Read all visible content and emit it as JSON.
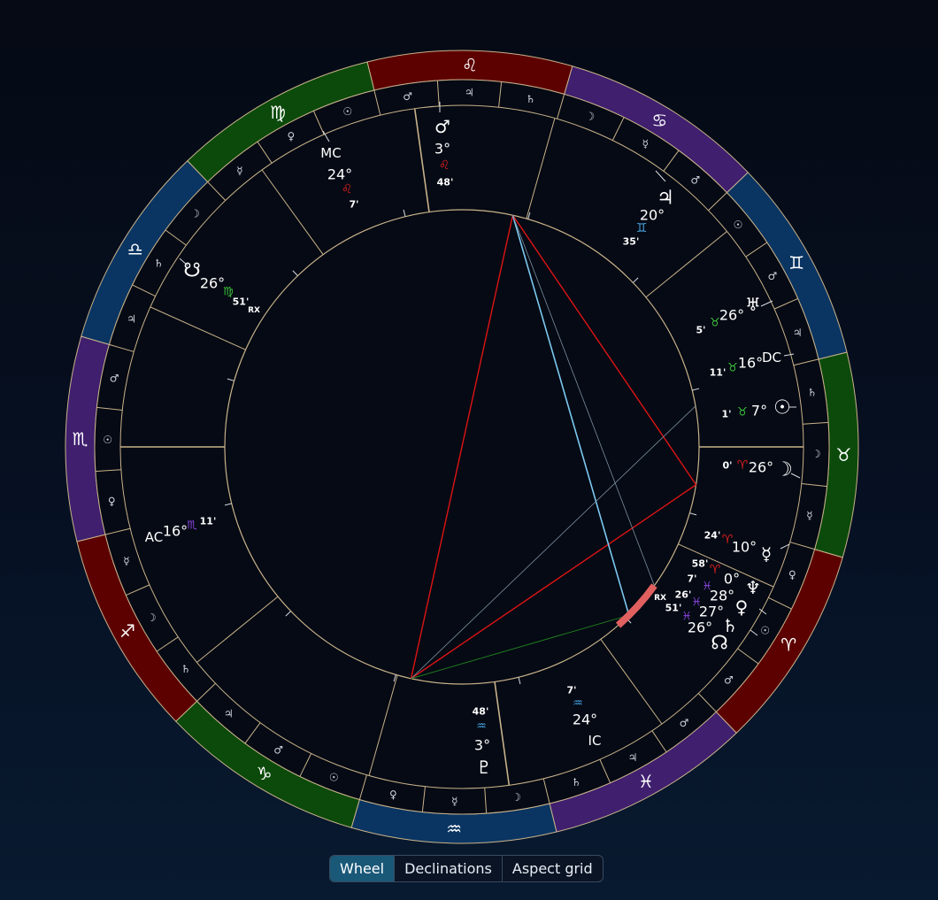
{
  "colors": {
    "fire": "#5c0000",
    "earth": "#0b4a0b",
    "air": "#0a3562",
    "water": "#3f1f6e",
    "ring_stroke": "#c9b28a",
    "label": "#ffffff",
    "aspect_red": "#dd1414",
    "aspect_blue": "#7cc8f0",
    "aspect_green": "#1f7a1f",
    "aspect_grey": "#7d8fa0",
    "highlight": "#e06060"
  },
  "zodiac": [
    {
      "sign": "aries",
      "glyph": "♈",
      "element": "fire",
      "rulers": [
        "♂",
        "☉",
        "♀"
      ]
    },
    {
      "sign": "taurus",
      "glyph": "♉",
      "element": "earth",
      "rulers": [
        "☿",
        "☽",
        "♄"
      ]
    },
    {
      "sign": "gemini",
      "glyph": "♊",
      "element": "air",
      "rulers": [
        "♃",
        "♂",
        "☉"
      ]
    },
    {
      "sign": "cancer",
      "glyph": "♋",
      "element": "water",
      "rulers": [
        "♂",
        "☿",
        "☽"
      ]
    },
    {
      "sign": "leo",
      "glyph": "♌",
      "element": "fire",
      "rulers": [
        "♄",
        "♃",
        "♂"
      ]
    },
    {
      "sign": "virgo",
      "glyph": "♍",
      "element": "earth",
      "rulers": [
        "☉",
        "♀",
        "☿"
      ]
    },
    {
      "sign": "libra",
      "glyph": "♎",
      "element": "air",
      "rulers": [
        "☽",
        "♄",
        "♃"
      ]
    },
    {
      "sign": "scorpio",
      "glyph": "♏",
      "element": "water",
      "rulers": [
        "♂",
        "☉",
        "♀"
      ]
    },
    {
      "sign": "sagittarius",
      "glyph": "♐",
      "element": "fire",
      "rulers": [
        "☿",
        "☽",
        "♄"
      ]
    },
    {
      "sign": "capricorn",
      "glyph": "♑",
      "element": "earth",
      "rulers": [
        "♃",
        "♂",
        "☉"
      ]
    },
    {
      "sign": "aquarius",
      "glyph": "♒",
      "element": "air",
      "rulers": [
        "♀",
        "☿",
        "☽"
      ]
    },
    {
      "sign": "pisces",
      "glyph": "♓",
      "element": "water",
      "rulers": [
        "♄",
        "♃",
        "♂"
      ]
    }
  ],
  "points": [
    {
      "name": "sun",
      "glyph": "☉",
      "deg": "7°",
      "sign_glyph": "♉",
      "min": "1'",
      "rx": "",
      "sign_color": "earth"
    },
    {
      "name": "moon",
      "glyph": "☽",
      "deg": "26°",
      "sign_glyph": "♈",
      "min": "0'",
      "rx": "",
      "sign_color": "fire"
    },
    {
      "name": "mercury",
      "glyph": "☿",
      "deg": "10°",
      "sign_glyph": "♈",
      "min": "24'",
      "rx": "",
      "sign_color": "fire"
    },
    {
      "name": "venus",
      "glyph": "♀",
      "deg": "27°",
      "sign_glyph": "♓",
      "min": "26'",
      "rx": "",
      "sign_color": "water"
    },
    {
      "name": "mars",
      "glyph": "♂",
      "deg": "3°",
      "sign_glyph": "♌",
      "min": "48'",
      "rx": "",
      "sign_color": "fire"
    },
    {
      "name": "jupiter",
      "glyph": "♃",
      "deg": "20°",
      "sign_glyph": "♊",
      "min": "35'",
      "rx": "",
      "sign_color": "air"
    },
    {
      "name": "saturn",
      "glyph": "♄",
      "deg": "26°",
      "sign_glyph": "♓",
      "min": "51'",
      "rx": "",
      "sign_color": "water"
    },
    {
      "name": "uranus",
      "glyph": "♅",
      "deg": "26°",
      "sign_glyph": "♉",
      "min": "5'",
      "rx": "",
      "sign_color": "earth"
    },
    {
      "name": "neptune",
      "glyph": "♆",
      "deg": "28°",
      "sign_glyph": "♓",
      "min": "7'",
      "rx": "",
      "sign_color": "water"
    },
    {
      "name": "pluto",
      "glyph": "♇",
      "deg": "3°",
      "sign_glyph": "♒",
      "min": "48'",
      "rx": "",
      "sign_color": "air"
    },
    {
      "name": "node",
      "glyph": "☊",
      "deg": "0°",
      "sign_glyph": "♈",
      "min": "58'",
      "rx": "RX",
      "sign_color": "fire"
    },
    {
      "name": "south-node",
      "glyph": "☋",
      "deg": "26°",
      "sign_glyph": "♍",
      "min": "51'",
      "rx": "RX",
      "sign_color": "earth"
    }
  ],
  "angles": [
    {
      "name": "asc",
      "label": "AC",
      "deg": "16°",
      "sign_glyph": "♏",
      "min": "11'",
      "sign_color": "water"
    },
    {
      "name": "mc",
      "label": "MC",
      "deg": "24°",
      "sign_glyph": "♌",
      "min": "7'",
      "sign_color": "fire"
    },
    {
      "name": "dsc",
      "label": "DC",
      "deg": "16°",
      "sign_glyph": "♉",
      "min": "11'",
      "sign_color": "earth"
    },
    {
      "name": "ic",
      "label": "IC",
      "deg": "24°",
      "sign_glyph": "♒",
      "min": "7'",
      "sign_color": "air"
    }
  ],
  "tabs": [
    {
      "label": "Wheel",
      "active": true
    },
    {
      "label": "Declinations",
      "active": false
    },
    {
      "label": "Aspect grid",
      "active": false
    }
  ]
}
